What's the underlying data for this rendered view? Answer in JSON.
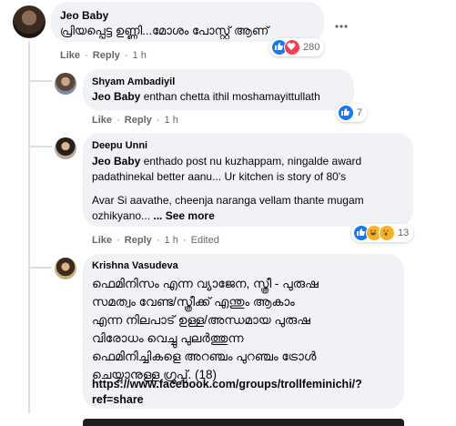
{
  "comments": [
    {
      "author": "Jeo Baby",
      "text": "പ്രിയപ്പെട്ട ഉണ്ണി...മോശം പോസ്റ്റ് ആണ്",
      "actions": {
        "like": "Like",
        "reply": "Reply",
        "time": "1 h"
      },
      "reactions": {
        "icons": [
          "like-icon",
          "love-icon"
        ],
        "count": "280"
      }
    },
    {
      "author": "Shyam Ambadiyil",
      "mention": "Jeo Baby",
      "text": " enthan chetta ithil moshamayittullath",
      "actions": {
        "like": "Like",
        "reply": "Reply",
        "time": "1 h"
      },
      "reactions": {
        "icons": [
          "like-icon"
        ],
        "count": "7"
      }
    },
    {
      "author": "Deepu Unni",
      "mention": "Jeo Baby",
      "text_line1": " enthado post nu kuzhappam, ningalde award",
      "text_line2": "padathinekal better aanu... Ur kitchen is story of 80's",
      "text_line3": "Avar Si aavathe, cheenja naranga vellam thante mugam",
      "text_line4": "ozhikyano... ",
      "see_more": "... See more",
      "actions": {
        "like": "Like",
        "reply": "Reply",
        "time": "1 h",
        "edited": "Edited"
      },
      "reactions": {
        "icons": [
          "like-icon",
          "haha-icon",
          "wow-icon"
        ],
        "count": "13"
      }
    },
    {
      "author": "Krishna Vasudeva",
      "lines": [
        "ഫെമിനിസം എന്ന വ്യാജേന, സ്ത്രീ - പുരുഷ",
        "സമത്വം വേണ്ട/സ്ത്രീക്ക് എന്തും ആകാം",
        "എന്ന നിലപാട് ഉള്ള/അന്ധമായ പുരുഷ",
        "വിരോധം വെച്ചു പുലർത്തുന്ന",
        "ഫെമിനിച്ചികളെ അറഞ്ചം പുറഞ്ചം ട്രോൾ",
        "ചെയ്യാനുള്ള ഗ്രൂപ്പ്. (18)"
      ],
      "link_line1": "https://www.facebook.com/groups/trollfeminichi/?",
      "link_line2": "ref=share"
    }
  ],
  "colors": {
    "bubble": "#f0f2f5",
    "meta": "#65676b",
    "like": "#1877f2",
    "love": "#f33e58",
    "haha": "#f7b125"
  }
}
